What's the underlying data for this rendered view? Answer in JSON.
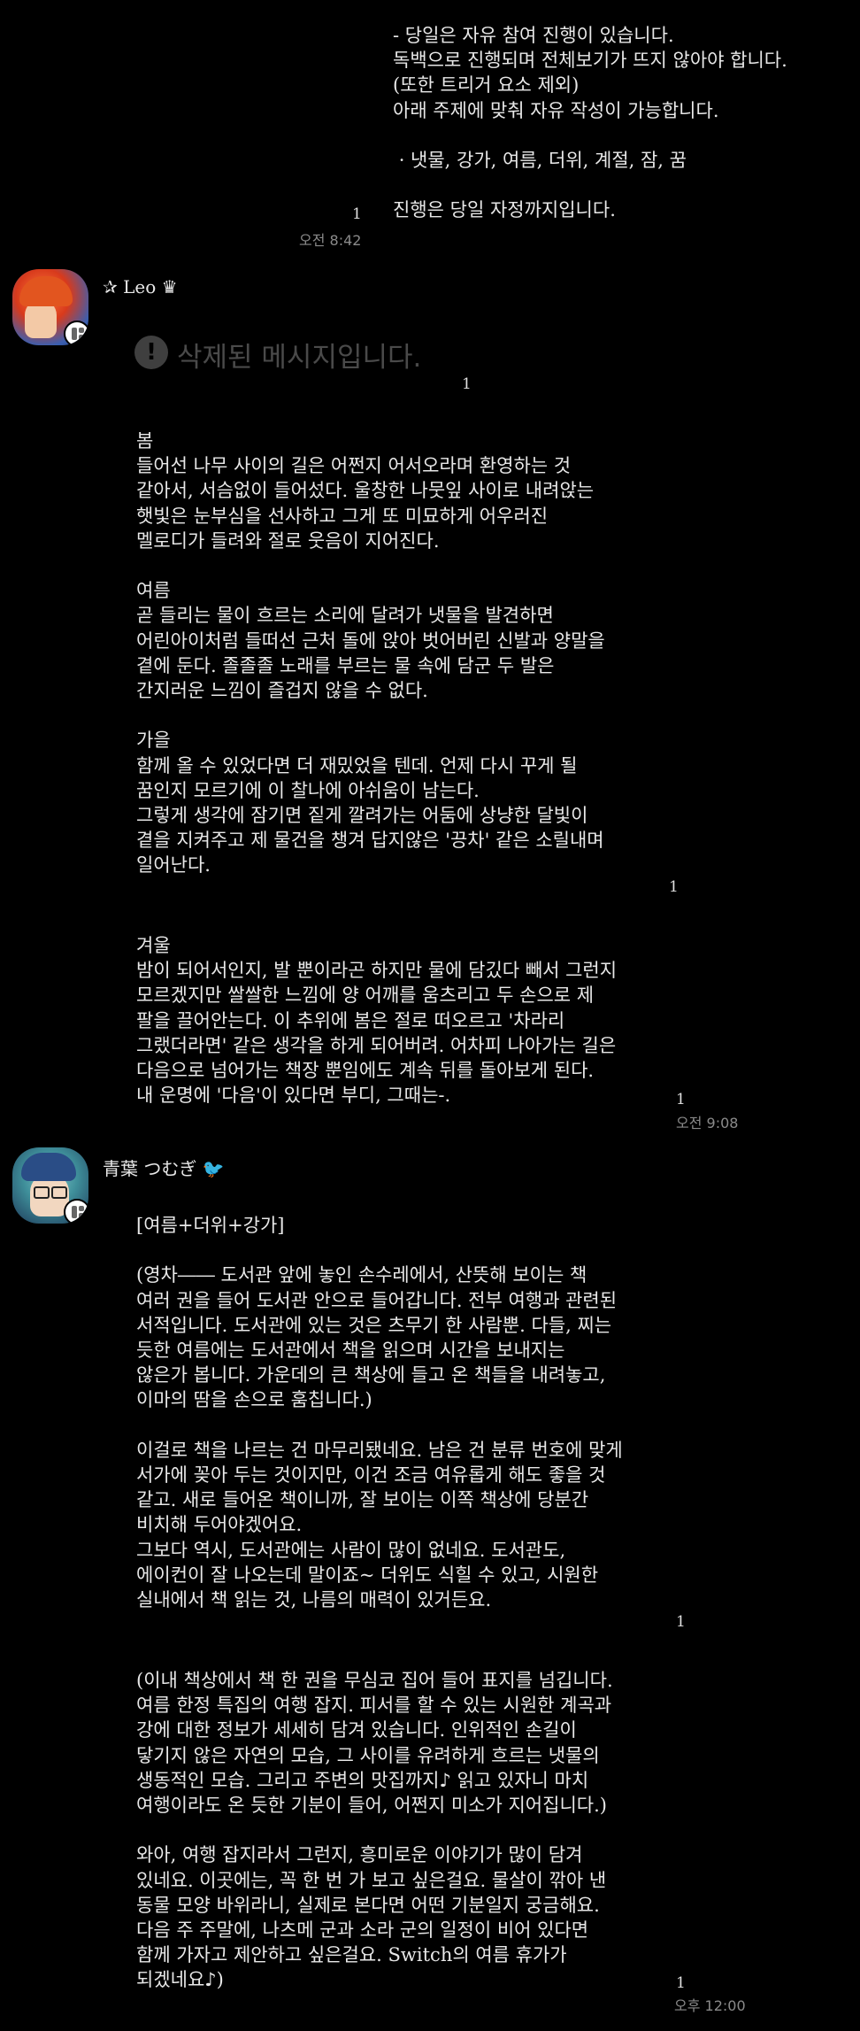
{
  "messages": {
    "announce": {
      "text": "- 당일은 자유 참여 진행이 있습니다.\n독백으로 진행되며 전체보기가 뜨지 않아야 합니다.\n(또한 트리거 요소 제외)\n아래 주제에 맞춰 자유 작성이 가능합니다.\n\n · 냇물, 강가, 여름, 더위, 계절, 잠, 꿈\n\n진행은 당일 자정까지입니다.",
      "unread": "1",
      "time": "오전 8:42"
    },
    "leo": {
      "name": "✰ Leo ♛",
      "deleted": "삭제된 메시지입니다.",
      "deleted_unread": "1",
      "msg1": "봄\n들어선 나무 사이의 길은 어쩐지 어서오라며 환영하는 것\n같아서, 서슴없이 들어섰다. 울창한 나뭇잎 사이로 내려앉는\n햇빛은 눈부심을 선사하고 그게 또 미묘하게 어우러진\n멜로디가 들려와 절로 웃음이 지어진다.\n\n여름\n곧 들리는 물이 흐르는 소리에 달려가 냇물을 발견하면\n어린아이처럼 들떠선 근처 돌에 앉아 벗어버린 신발과 양말을\n곁에 둔다. 졸졸졸 노래를 부르는 물 속에 담군 두 발은\n간지러운 느낌이 즐겁지 않을 수 없다.\n\n가을\n함께 올 수 있었다면 더 재밌었을 텐데. 언제 다시 꾸게 될\n꿈인지 모르기에 이 찰나에 아쉬움이 남는다.\n그렇게 생각에 잠기면 짙게 깔려가는 어둠에 상냥한 달빛이\n곁을 지켜주고 제 물건을 챙겨 답지않은 '끙차' 같은 소릴내며\n일어난다.",
      "msg1_unread": "1",
      "msg2": "겨울\n밤이 되어서인지, 발 뿐이라곤 하지만 물에 담깄다 빼서 그런지\n모르겠지만 쌀쌀한 느낌에 양 어깨를 움츠리고 두 손으로 제\n팔을 끌어안는다. 이 추위에 봄은 절로 떠오르고 '차라리\n그랬더라면' 같은 생각을 하게 되어버려. 어차피 나아가는 길은\n다음으로 넘어가는 책장 뿐임에도 계속 뒤를 돌아보게 된다.\n내 운명에 '다음'이 있다면 부디, 그때는-.",
      "msg2_unread": "1",
      "time": "오전 9:08"
    },
    "tsumugi": {
      "name": "青葉 つむぎ 🐦",
      "msg1": "[여름+더위+강가]\n\n(영차―― 도서관 앞에 놓인 손수레에서, 산뜻해 보이는 책\n여러 권을 들어 도서관 안으로 들어갑니다. 전부 여행과 관련된\n서적입니다. 도서관에 있는 것은 츠무기 한 사람뿐. 다들, 찌는\n듯한 여름에는 도서관에서 책을 읽으며 시간을 보내지는\n않은가 봅니다. 가운데의 큰 책상에 들고 온 책들을 내려놓고,\n이마의 땀을 손으로 훔칩니다.)\n\n이걸로 책을 나르는 건 마무리됐네요. 남은 건 분류 번호에 맞게\n서가에 꽂아 두는 것이지만, 이건 조금 여유롭게 해도 좋을 것\n같고. 새로 들어온 책이니까, 잘 보이는 이쪽 책상에 당분간\n비치해 두어야겠어요.\n그보다 역시, 도서관에는 사람이 많이 없네요. 도서관도,\n에이컨이 잘 나오는데 말이죠~ 더위도 식힐 수 있고, 시원한\n실내에서 책 읽는 것, 나름의 매력이 있거든요.",
      "msg1_unread": "1",
      "msg2": "(이내 책상에서 책 한 권을 무심코 집어 들어 표지를 넘깁니다.\n여름 한정 특집의 여행 잡지. 피서를 할 수 있는 시원한 계곡과\n강에 대한 정보가 세세히 담겨 있습니다. 인위적인 손길이\n닿기지 않은 자연의 모습, 그 사이를 유려하게 흐르는 냇물의\n생동적인 모습. 그리고 주변의 맛집까지♪ 읽고 있자니 마치\n여행이라도 온 듯한 기분이 들어, 어쩐지 미소가 지어집니다.)\n\n와아, 여행 잡지라서 그런지, 흥미로운 이야기가 많이 담겨\n있네요. 이곳에는, 꼭 한 번 가 보고 싶은걸요. 물살이 깎아 낸\n동물 모양 바위라니, 실제로 본다면 어떤 기분일지 궁금해요.\n다음 주 주말에, 나츠메 군과 소라 군의 일정이 비어 있다면\n함께 가자고 제안하고 싶은걸요. Switch의 여름 휴가가\n되겠네요♪)",
      "msg2_unread": "1",
      "time": "오후 12:00"
    }
  }
}
